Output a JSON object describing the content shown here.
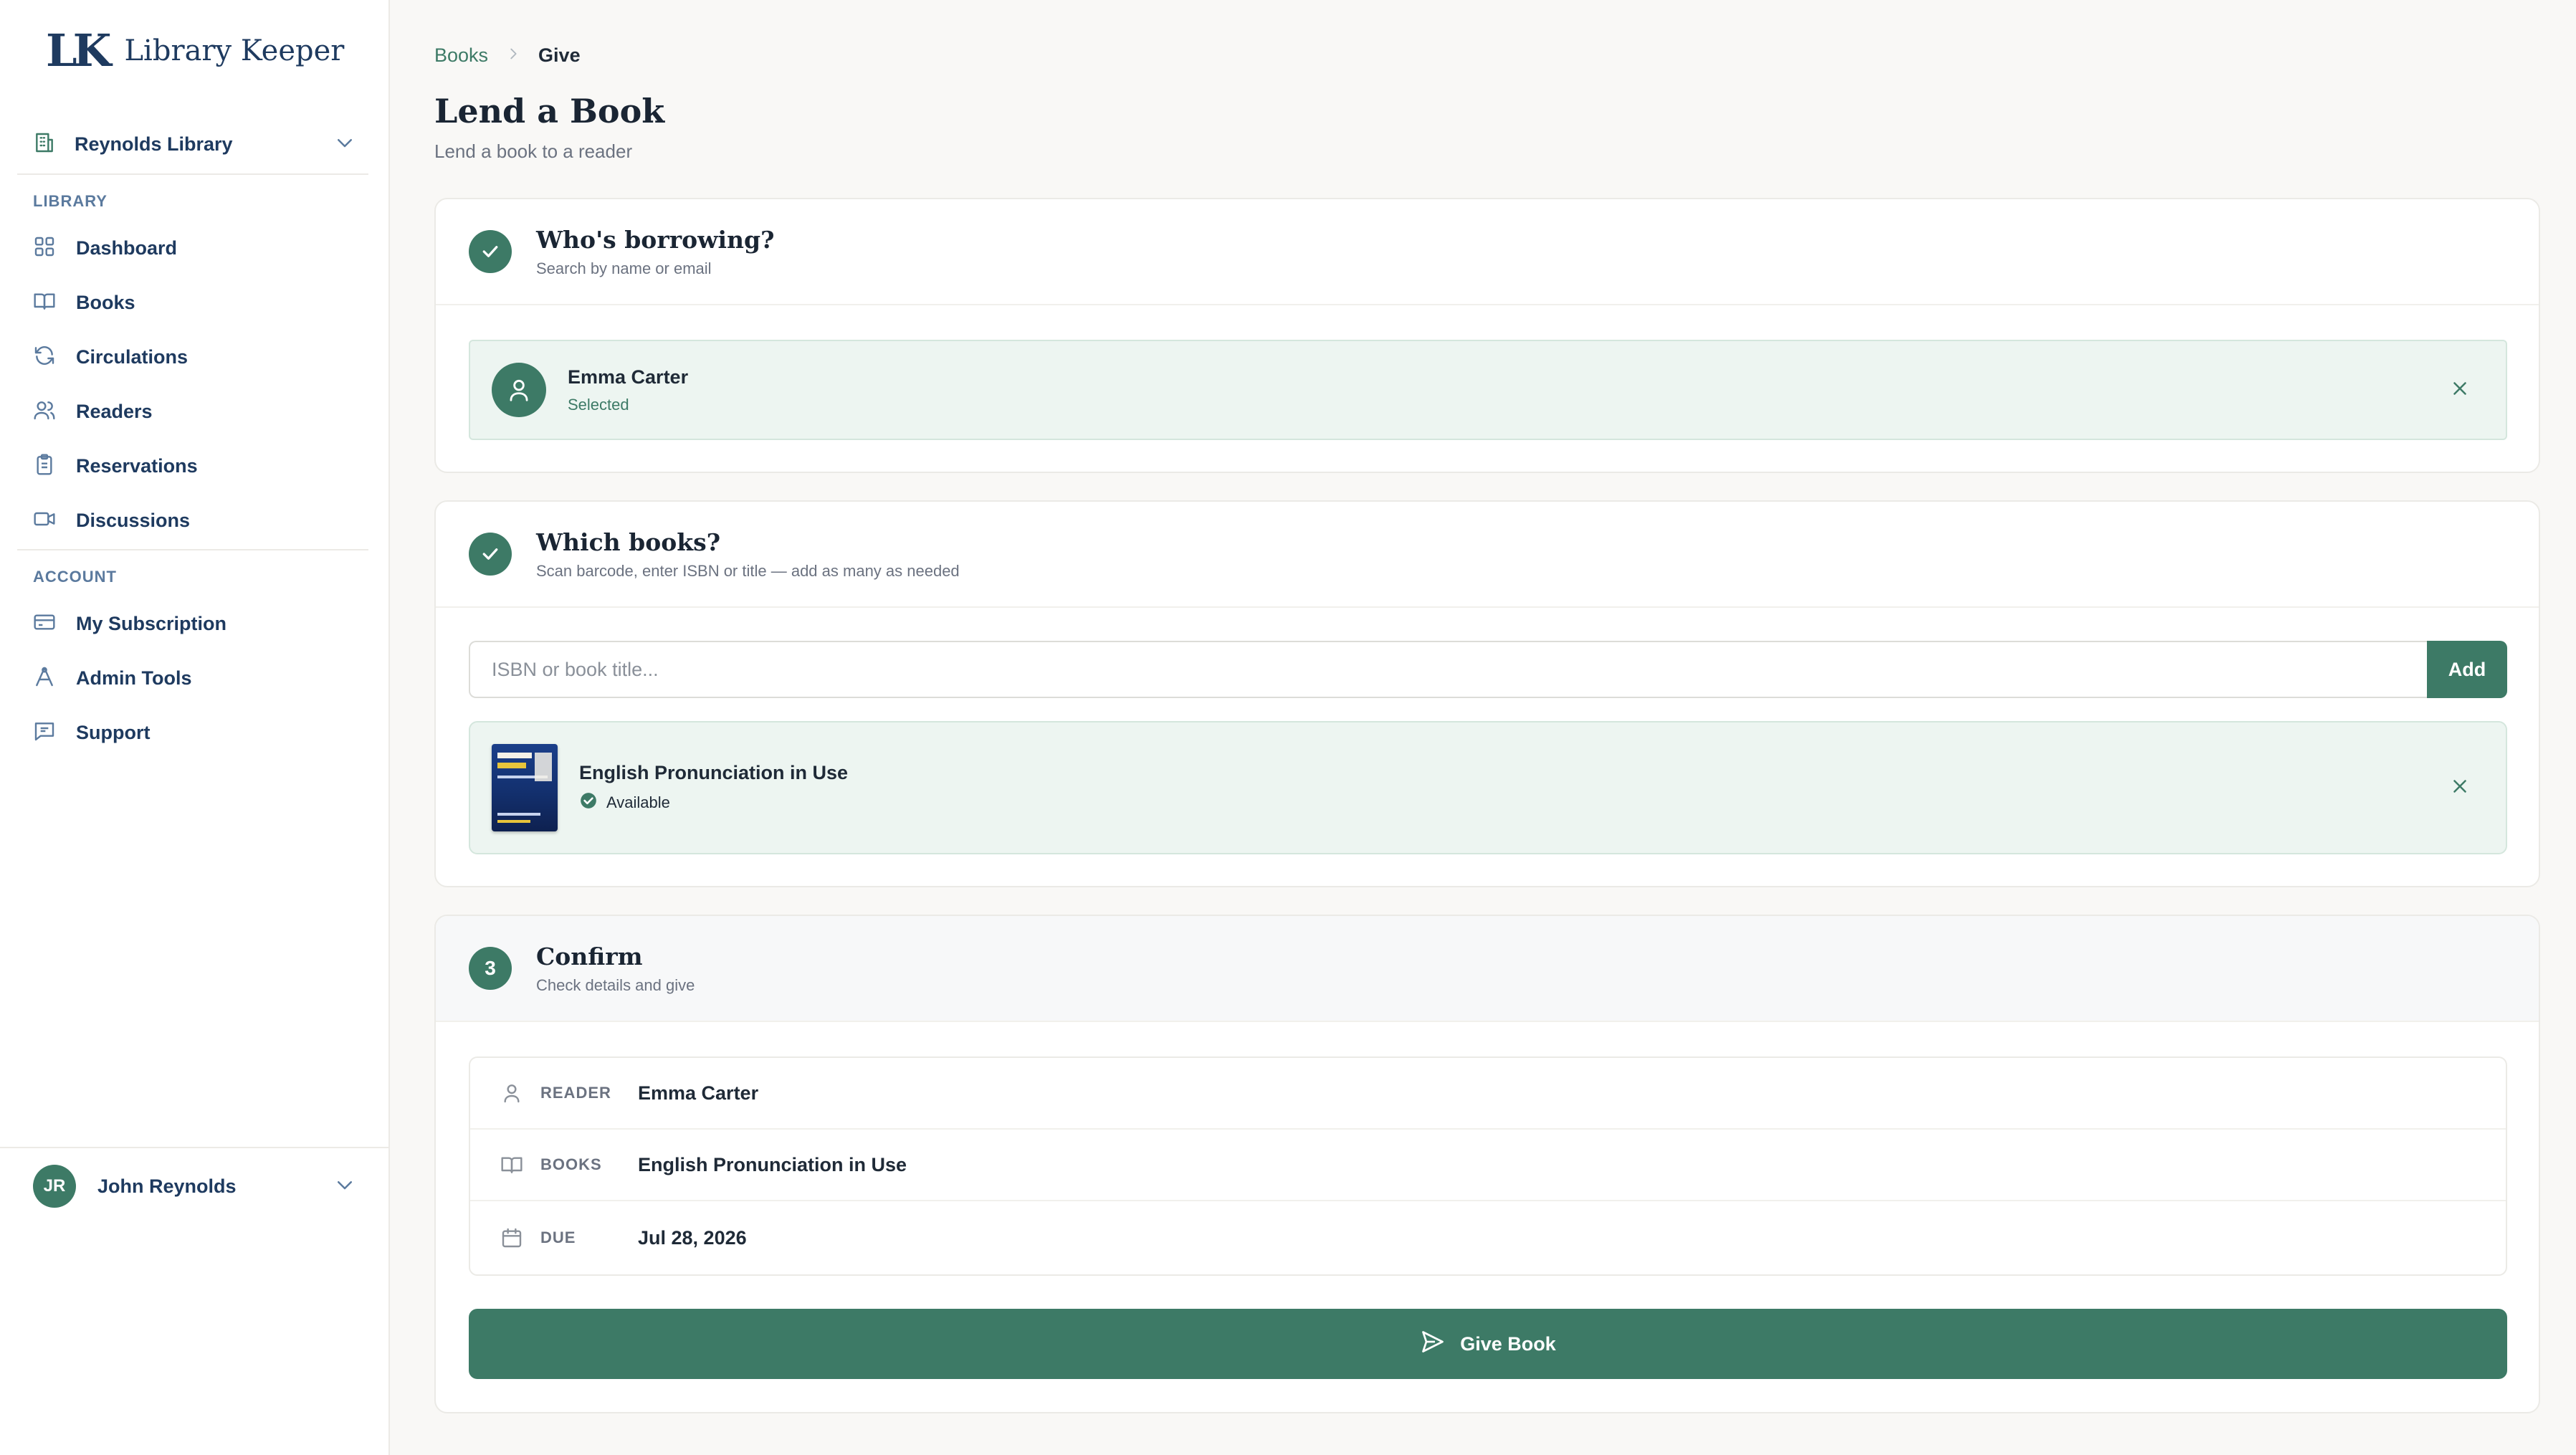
{
  "app": {
    "logo_mark": "LK",
    "name": "Library Keeper"
  },
  "library_selector": {
    "name": "Reynolds Library"
  },
  "nav": {
    "library_section_label": "LIBRARY",
    "library_items": [
      {
        "label": "Dashboard",
        "icon": "grid-icon"
      },
      {
        "label": "Books",
        "icon": "book-icon"
      },
      {
        "label": "Circulations",
        "icon": "refresh-icon"
      },
      {
        "label": "Readers",
        "icon": "users-icon"
      },
      {
        "label": "Reservations",
        "icon": "clipboard-icon"
      },
      {
        "label": "Discussions",
        "icon": "video-icon"
      }
    ],
    "account_section_label": "ACCOUNT",
    "account_items": [
      {
        "label": "My Subscription",
        "icon": "credit-card-icon"
      },
      {
        "label": "Admin Tools",
        "icon": "tools-icon"
      },
      {
        "label": "Support",
        "icon": "message-icon"
      }
    ]
  },
  "user": {
    "initials": "JR",
    "name": "John Reynolds"
  },
  "breadcrumb": {
    "parent": "Books",
    "current": "Give"
  },
  "page": {
    "title": "Lend a Book",
    "subtitle": "Lend a book to a reader"
  },
  "step1": {
    "title": "Who's borrowing?",
    "subtitle": "Search by name or email",
    "reader_name": "Emma Carter",
    "reader_status": "Selected"
  },
  "step2": {
    "title": "Which books?",
    "subtitle": "Scan barcode, enter ISBN or title — add as many as needed",
    "input_placeholder": "ISBN or book title...",
    "add_label": "Add",
    "book_title": "English Pronunciation in Use",
    "book_status": "Available"
  },
  "step3": {
    "number": "3",
    "title": "Confirm",
    "subtitle": "Check details and give",
    "rows": [
      {
        "key": "READER",
        "value": "Emma Carter"
      },
      {
        "key": "BOOKS",
        "value": "English Pronunciation in Use"
      },
      {
        "key": "DUE",
        "value": "Jul 28, 2026"
      }
    ],
    "give_label": "Give Book"
  },
  "colors": {
    "accent": "#3d7a66",
    "navy": "#1e3a5f",
    "selected_bg": "#edf5f1"
  }
}
